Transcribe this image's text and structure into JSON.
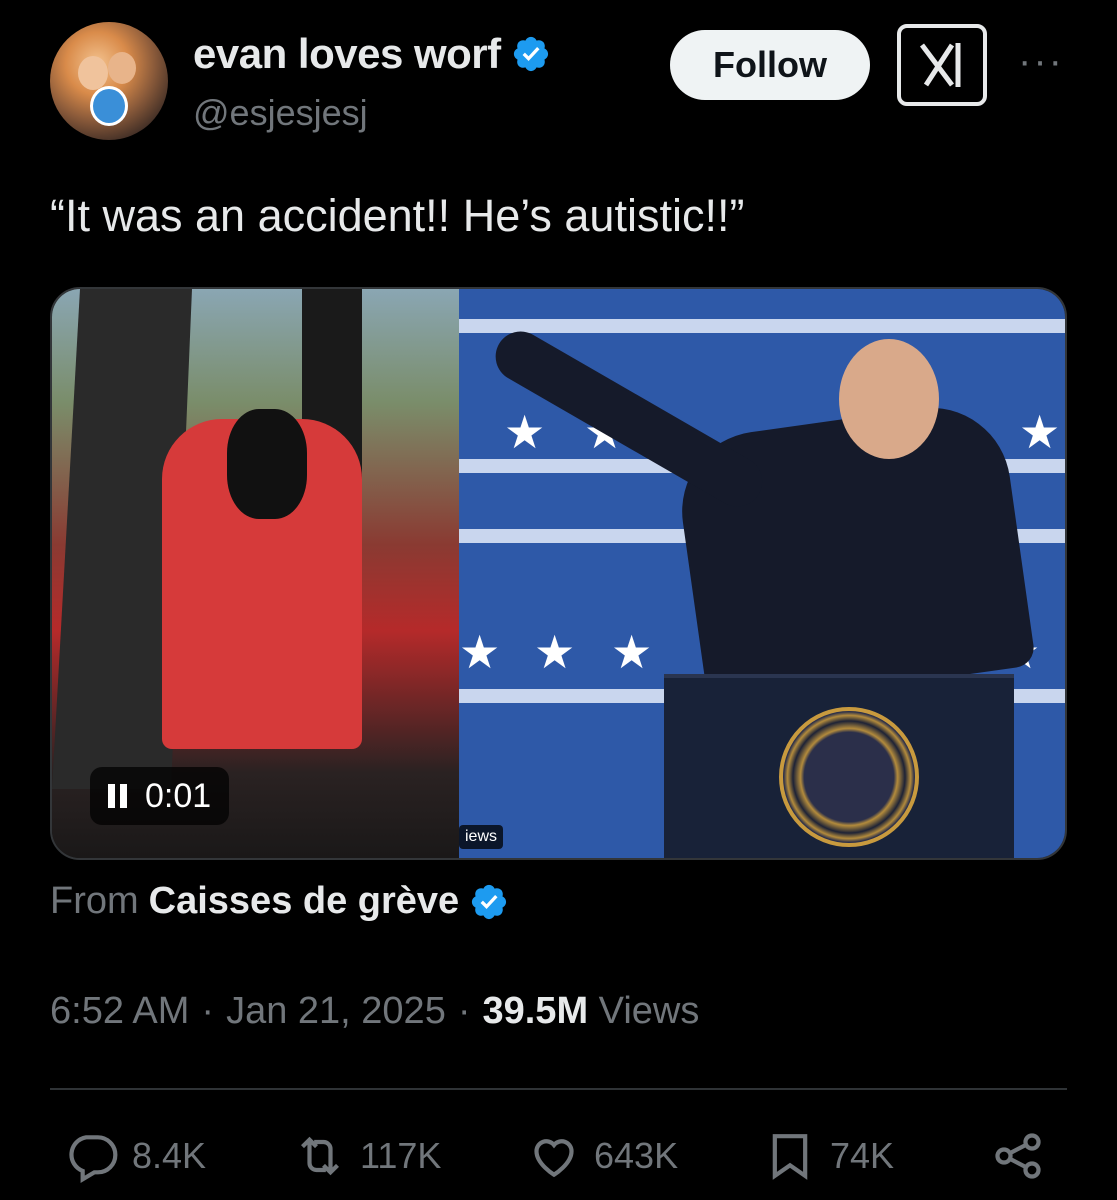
{
  "author": {
    "display_name": "evan loves worf",
    "handle": "@esjesjesj"
  },
  "buttons": {
    "follow_label": "Follow",
    "more_label": "···"
  },
  "tweet": {
    "text": "“It was an accident!! He’s autistic!!”"
  },
  "media": {
    "timer": "0:01",
    "views_chip": "iews"
  },
  "source": {
    "prefix": "From",
    "name": "Caisses de grève"
  },
  "meta": {
    "time": "6:52 AM",
    "separator": "·",
    "date": "Jan 21, 2025",
    "views_count": "39.5M",
    "views_label": "Views"
  },
  "actions": {
    "replies": "8.4K",
    "reposts": "117K",
    "likes": "643K",
    "bookmarks": "74K"
  },
  "colors": {
    "background": "#000000",
    "verified": "#1d9bf0",
    "text_primary": "#e7e9ea",
    "text_secondary": "#71767b"
  },
  "icons": [
    "verified-badge-icon",
    "grok-icon",
    "more-icon",
    "pause-icon",
    "reply-icon",
    "repost-icon",
    "like-icon",
    "bookmark-icon",
    "share-icon"
  ]
}
